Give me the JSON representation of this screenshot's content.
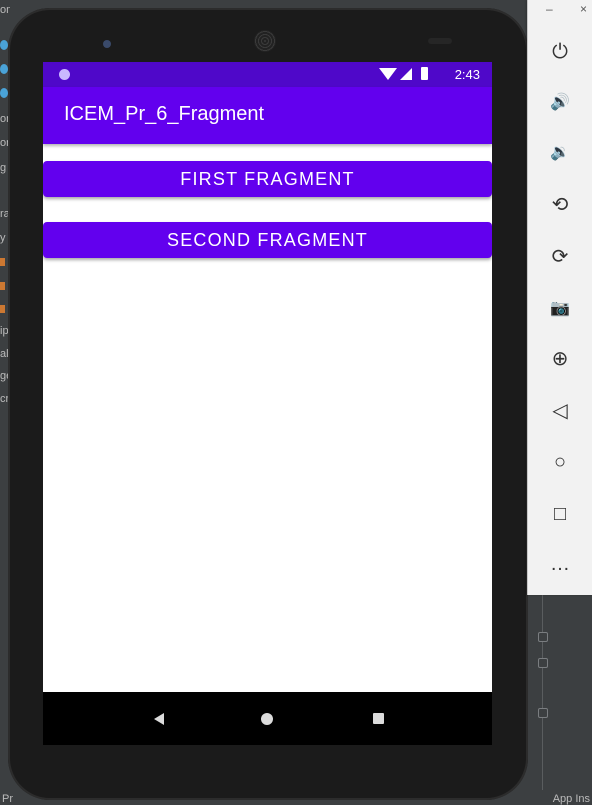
{
  "app": {
    "title": "ICEM_Pr_6_Fragment",
    "status_time": "2:43",
    "buttons": {
      "first": "FIRST FRAGMENT",
      "second": "SECOND FRAGMENT"
    }
  },
  "ide": {
    "left_fragments": [
      "om",
      "on",
      "on",
      "g",
      "ra",
      "y",
      "ip",
      "alu",
      "ge",
      "cri"
    ],
    "bottom_left": "Pr",
    "bottom_right": "App Ins"
  },
  "toolbar": {
    "minimize": "–",
    "close": "×",
    "icons": [
      "power-icon",
      "volume-up-icon",
      "volume-down-icon",
      "rotate-left-icon",
      "rotate-right-icon",
      "camera-icon",
      "zoom-icon",
      "back-icon",
      "home-icon",
      "overview-icon",
      "more-icon"
    ],
    "glyphs": {
      "power": "⏻",
      "volume_up": "🔊",
      "volume_down": "🔉",
      "rotate_left": "⟲",
      "rotate_right": "⟳",
      "camera": "📷",
      "zoom": "⊕",
      "back": "◁",
      "home": "○",
      "overview": "□",
      "more": "…"
    }
  },
  "colors": {
    "primary": "#6200ee",
    "primary_dark": "#4f08c9"
  }
}
